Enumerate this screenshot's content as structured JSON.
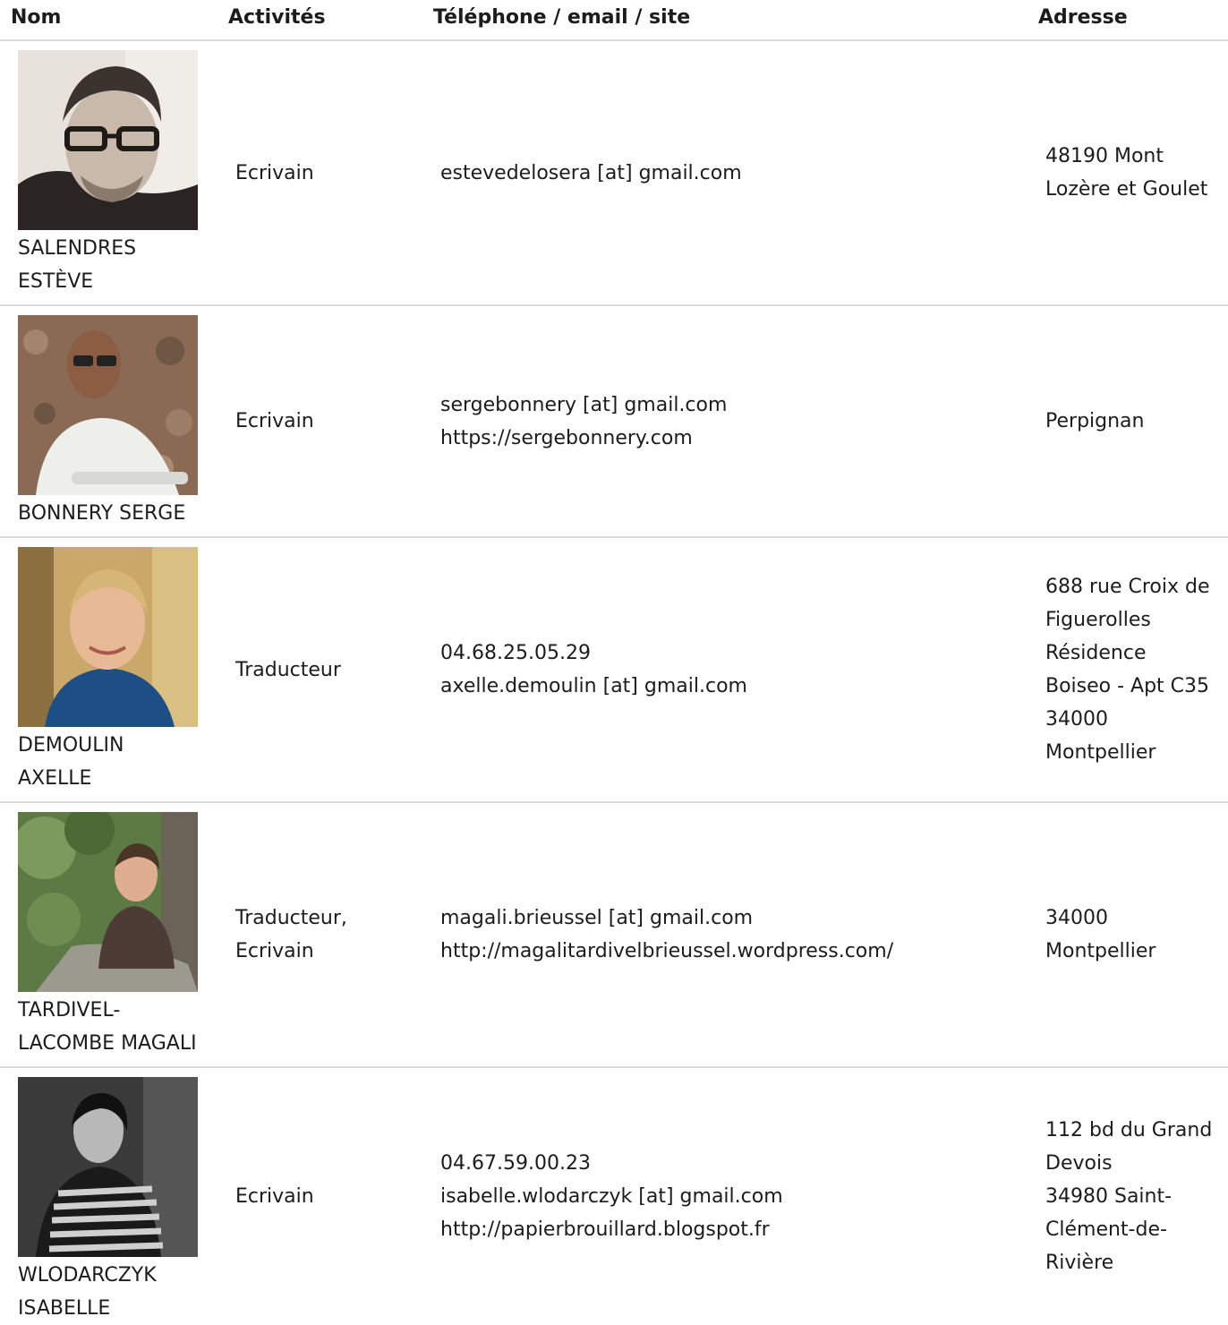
{
  "headers": {
    "nom": "Nom",
    "activites": "Activités",
    "contact": "Téléphone / email / site",
    "adresse": "Adresse"
  },
  "rows": [
    {
      "name": "SALENDRES\nESTÈVE",
      "activity": "Ecrivain",
      "contact": "estevedelosera [at] gmail.com",
      "address": "48190 Mont\nLozère et Goulet"
    },
    {
      "name": "BONNERY SERGE",
      "activity": "Ecrivain",
      "contact": "sergebonnery [at] gmail.com\nhttps://sergebonnery.com",
      "address": "Perpignan"
    },
    {
      "name": "DEMOULIN\nAXELLE",
      "activity": "Traducteur",
      "contact": "04.68.25.05.29\naxelle.demoulin [at] gmail.com",
      "address": "688 rue Croix de\nFiguerolles\nRésidence\nBoiseo - Apt C35\n34000\nMontpellier"
    },
    {
      "name": "TARDIVEL-\nLACOMBE MAGALI",
      "activity": "Traducteur,\nEcrivain",
      "contact": "magali.brieussel [at] gmail.com\nhttp://magalitardivelbrieussel.wordpress.com/",
      "address": "34000\nMontpellier"
    },
    {
      "name": "WLODARCZYK\nISABELLE",
      "activity": "Ecrivain",
      "contact": "04.67.59.00.23\nisabelle.wlodarczyk [at] gmail.com\nhttp://papierbrouillard.blogspot.fr",
      "address": "112 bd du Grand\nDevois\n34980 Saint-\nClément-de-\nRivière"
    }
  ]
}
